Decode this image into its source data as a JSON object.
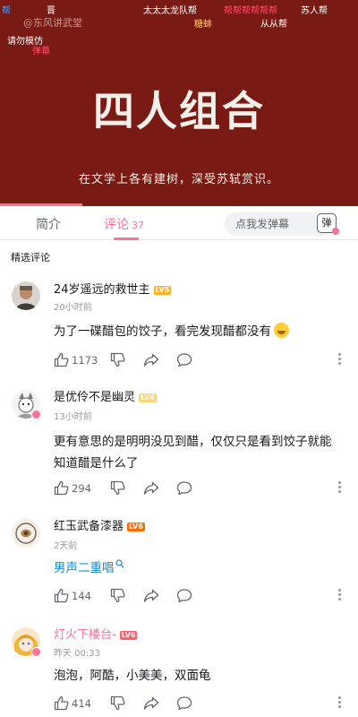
{
  "video": {
    "danmaku": [
      {
        "text": "帮",
        "color": "#4c9bff"
      },
      {
        "text": "晋",
        "color": "#ffffff"
      },
      {
        "text": "太太太龙队帮",
        "color": "#ffffff"
      },
      {
        "text": "帮帮帮帮帮帮",
        "color": "#ff4d6d"
      },
      {
        "text": "苏人帮",
        "color": "#ffffff"
      },
      {
        "text": "糖蚌",
        "color": "#ffd94a"
      },
      {
        "text": "从从帮",
        "color": "#ffffff"
      },
      {
        "text": "弹幕",
        "color": "#ff4d6d"
      }
    ],
    "watermark": "@东风讲武堂",
    "watermark_note": "请勿模仿",
    "title": "四人组合",
    "subtitle": "在文学上各有建树，深受苏轼赏识。",
    "progress_fraction": 0.23
  },
  "tabs": {
    "intro": "简介",
    "comments": "评论",
    "comment_count": "37",
    "danmaku_placeholder": "点我发弹幕",
    "danmaku_btn": "弹"
  },
  "section_title": "精选评论",
  "comments": [
    {
      "user": "24岁遥远的救世主",
      "level": "LV5",
      "time": "20小时前",
      "text": "为了一碟醋包的饺子，看完发现醋都没有",
      "emoji": "laugh-cry-emoji",
      "likes": "1173"
    },
    {
      "user": "是优伶不是幽灵",
      "level": "LV4",
      "time": "13小时前",
      "text": "更有意思的是明明没见到醋，仅仅只是看到饺子就能知道醋是什么了",
      "likes": "294"
    },
    {
      "user": "红玉武备漆器",
      "level": "LV6",
      "time": "2天前",
      "text": "男声二重唱",
      "likes": "144"
    },
    {
      "user": "灯火下楼台-",
      "level": "LV6",
      "time": "昨天 00:33",
      "text": "泡泡，阿酷，小美美，双面龟",
      "likes": "414"
    }
  ],
  "colors": {
    "accent": "#fb7299",
    "video_bg": "#7a1a14",
    "link": "#178bcf"
  }
}
